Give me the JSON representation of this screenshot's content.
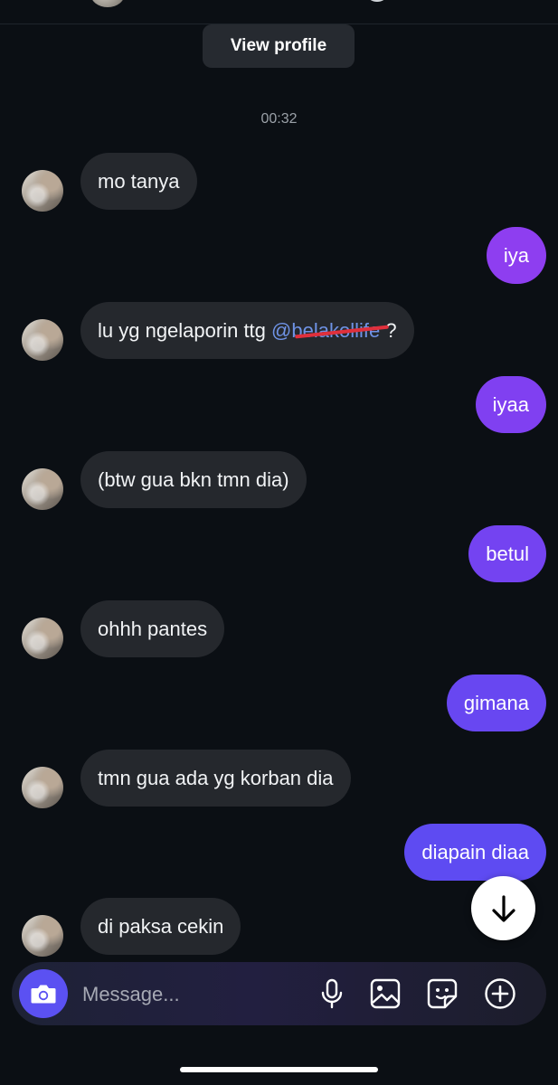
{
  "header": {
    "view_profile_label": "View profile",
    "timestamp": "00:32"
  },
  "messages": [
    {
      "side": "in",
      "text": "mo tanya"
    },
    {
      "side": "out",
      "text": "iya"
    },
    {
      "side": "in",
      "text_before": "lu yg ngelaporin ttg ",
      "mention": "@belakollife",
      "text_after": " ?"
    },
    {
      "side": "out",
      "text": "iyaa"
    },
    {
      "side": "in",
      "text": "(btw gua bkn tmn dia)"
    },
    {
      "side": "out",
      "text": "betul"
    },
    {
      "side": "in",
      "text": "ohhh pantes"
    },
    {
      "side": "out",
      "text": "gimana"
    },
    {
      "side": "in",
      "text": "tmn gua ada yg korban dia"
    },
    {
      "side": "out",
      "text": "diapain diaa"
    },
    {
      "side": "in",
      "text": "di paksa cekin"
    }
  ],
  "composer": {
    "placeholder": "Message...",
    "icons": [
      "camera-icon",
      "microphone-icon",
      "gallery-icon",
      "sticker-icon",
      "plus-icon"
    ]
  },
  "scroll_button_icon": "arrow-down-icon",
  "colors": {
    "background": "#0b0f14",
    "incoming_bubble": "#25282d",
    "outgoing_gradient": [
      "#8a3ff0",
      "#5a4ff2"
    ],
    "mention": "#6f93e6",
    "camera_button": "#5b51f2"
  }
}
